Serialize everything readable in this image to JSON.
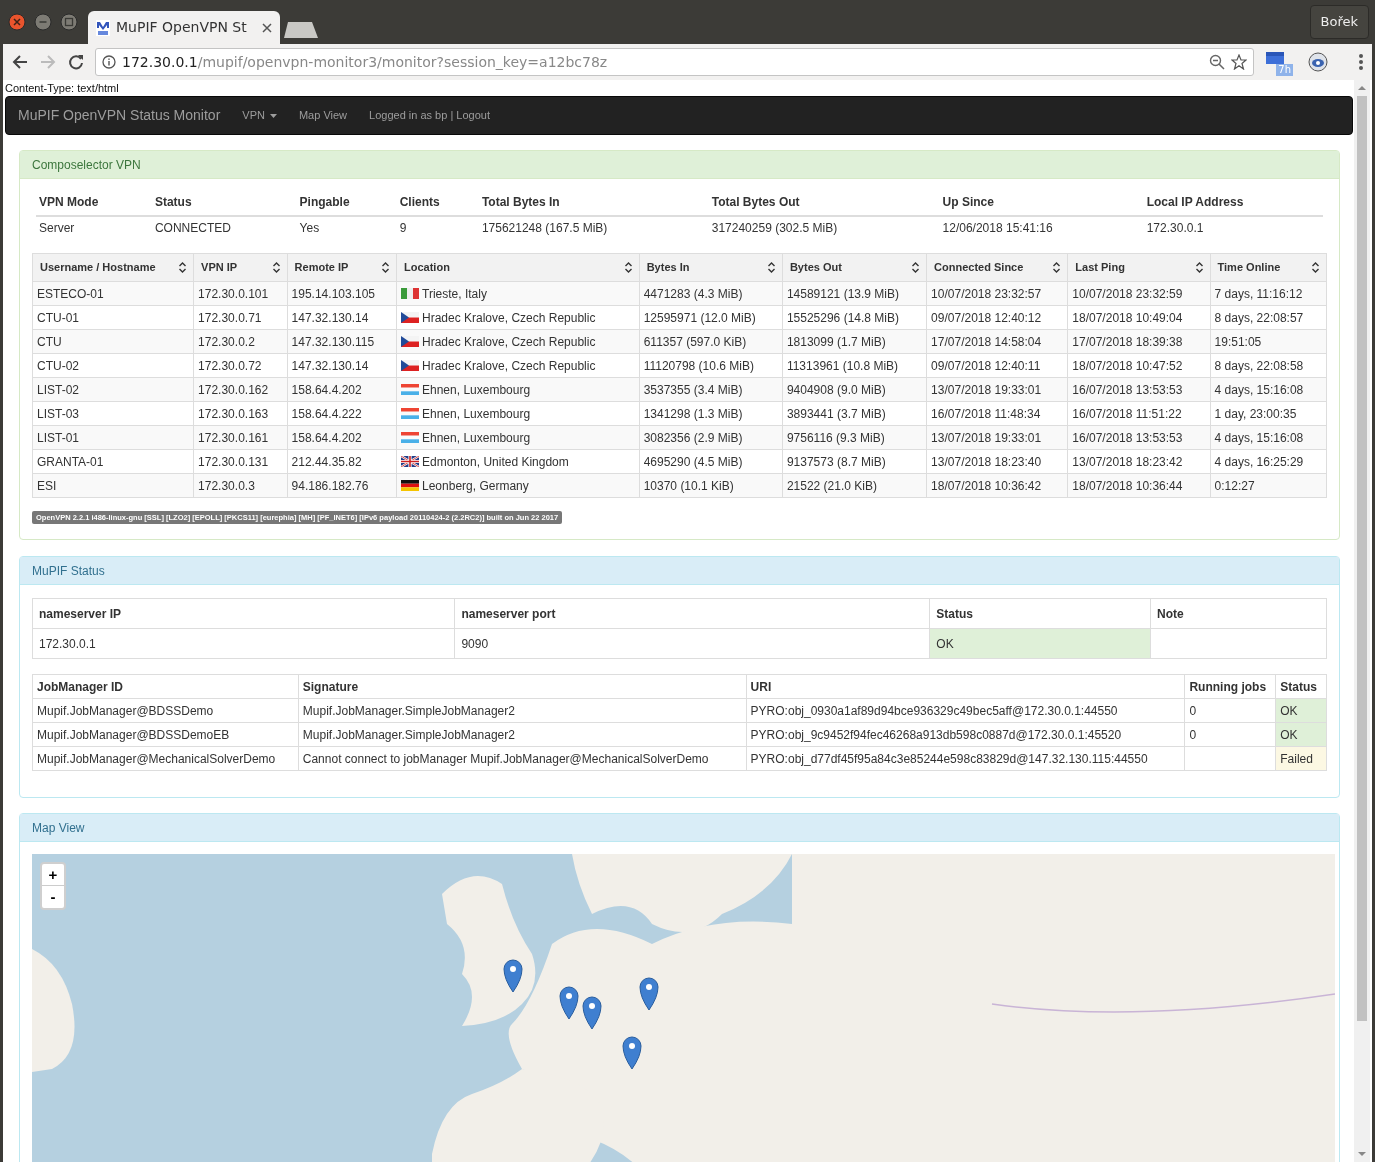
{
  "browser": {
    "tab_title": "MuPIF OpenVPN St",
    "profile": "Bořek",
    "url_host": "172.30.0.1",
    "url_path": "/mupif/openvpn-monitor3/monitor?session_key=a12bc78z",
    "forward_enabled": false,
    "extension_badge": "7h"
  },
  "content_type_line": "Content-Type: text/html",
  "navbar": {
    "brand": "MuPIF OpenVPN Status Monitor",
    "items": [
      {
        "label": "VPN",
        "kind": "dropdown"
      },
      {
        "label": "Map View",
        "kind": "link"
      },
      {
        "label": "Logged in as bp | Logout",
        "kind": "link"
      }
    ]
  },
  "vpn_panel": {
    "title": "Composelector VPN",
    "summary": {
      "columns": [
        "VPN Mode",
        "Status",
        "Pingable",
        "Clients",
        "Total Bytes In",
        "Total Bytes Out",
        "Up Since",
        "Local IP Address"
      ],
      "values": [
        "Server",
        "CONNECTED",
        "Yes",
        "9",
        "175621248 (167.5 MiB)",
        "317240259 (302.5 MiB)",
        "12/06/2018 15:41:16",
        "172.30.0.1"
      ]
    },
    "clients": {
      "columns": [
        "Username / Hostname",
        "VPN IP",
        "Remote IP",
        "Location",
        "Bytes In",
        "Bytes Out",
        "Connected Since",
        "Last Ping",
        "Time Online"
      ],
      "rows": [
        {
          "kind": "italy",
          "cells": [
            "ESTECO-01",
            "172.30.0.101",
            "195.14.103.105",
            "Trieste, Italy",
            "4471283 (4.3 MiB)",
            "14589121 (13.9 MiB)",
            "10/07/2018 23:32:57",
            "10/07/2018 23:32:59",
            "7 days, 11:16:12"
          ]
        },
        {
          "kind": "czechia",
          "cells": [
            "CTU-01",
            "172.30.0.71",
            "147.32.130.14",
            "Hradec Kralove, Czech Republic",
            "12595971 (12.0 MiB)",
            "15525296 (14.8 MiB)",
            "09/07/2018 12:40:12",
            "18/07/2018 10:49:04",
            "8 days, 22:08:57"
          ]
        },
        {
          "kind": "czechia",
          "cells": [
            "CTU",
            "172.30.0.2",
            "147.32.130.115",
            "Hradec Kralove, Czech Republic",
            "611357 (597.0 KiB)",
            "1813099 (1.7 MiB)",
            "17/07/2018 14:58:04",
            "17/07/2018 18:39:38",
            "19:51:05"
          ]
        },
        {
          "kind": "czechia",
          "cells": [
            "CTU-02",
            "172.30.0.72",
            "147.32.130.14",
            "Hradec Kralove, Czech Republic",
            "11120798 (10.6 MiB)",
            "11313961 (10.8 MiB)",
            "09/07/2018 12:40:11",
            "18/07/2018 10:47:52",
            "8 days, 22:08:58"
          ]
        },
        {
          "kind": "luxembourg",
          "cells": [
            "LIST-02",
            "172.30.0.162",
            "158.64.4.202",
            "Ehnen, Luxembourg",
            "3537355 (3.4 MiB)",
            "9404908 (9.0 MiB)",
            "13/07/2018 19:33:01",
            "16/07/2018 13:53:53",
            "4 days, 15:16:08"
          ]
        },
        {
          "kind": "luxembourg",
          "cells": [
            "LIST-03",
            "172.30.0.163",
            "158.64.4.222",
            "Ehnen, Luxembourg",
            "1341298 (1.3 MiB)",
            "3893441 (3.7 MiB)",
            "16/07/2018 11:48:34",
            "16/07/2018 11:51:22",
            "1 day, 23:00:35"
          ]
        },
        {
          "kind": "luxembourg",
          "cells": [
            "LIST-01",
            "172.30.0.161",
            "158.64.4.202",
            "Ehnen, Luxembourg",
            "3082356 (2.9 MiB)",
            "9756116 (9.3 MiB)",
            "13/07/2018 19:33:01",
            "16/07/2018 13:53:53",
            "4 days, 15:16:08"
          ]
        },
        {
          "kind": "britain",
          "cells": [
            "GRANTA-01",
            "172.30.0.131",
            "212.44.35.82",
            "Edmonton, United Kingdom",
            "4695290 (4.5 MiB)",
            "9137573 (8.7 MiB)",
            "13/07/2018 18:23:40",
            "13/07/2018 18:23:42",
            "4 days, 16:25:29"
          ]
        },
        {
          "kind": "germany",
          "cells": [
            "ESI",
            "172.30.0.3",
            "94.186.182.76",
            "Leonberg, Germany",
            "10370 (10.1 KiB)",
            "21522 (21.0 KiB)",
            "18/07/2018 10:36:42",
            "18/07/2018 10:36:44",
            "0:12:27"
          ]
        }
      ]
    },
    "version_badge": "OpenVPN 2.2.1 i486-linux-gnu [SSL] [LZO2] [EPOLL] [PKCS11] [eurephia] [MH] [PF_INET6] [IPv6 payload 20110424-2 (2.2RC2)] built on Jun 22 2017"
  },
  "mupif_panel": {
    "title": "MuPIF Status",
    "nameserver": {
      "columns": [
        "nameserver IP",
        "nameserver port",
        "Status",
        "Note"
      ],
      "values": [
        "172.30.0.1",
        "9090",
        "OK"
      ],
      "kind": "ok"
    },
    "jobmanagers": {
      "columns": [
        "JobManager ID",
        "Signature",
        "URI",
        "Running jobs",
        "Status"
      ],
      "rows": [
        {
          "id": "Mupif.JobManager@BDSSDemo",
          "signature": "Mupif.JobManager.SimpleJobManager2",
          "uri": "PYRO:obj_0930a1af89d94bce936329c49bec5aff@172.30.0.1:44550",
          "running_jobs": "0",
          "status": "OK",
          "kind": "ok"
        },
        {
          "id": "Mupif.JobManager@BDSSDemoEB",
          "signature": "Mupif.JobManager.SimpleJobManager2",
          "uri": "PYRO:obj_9c9452f94fec46268a913db598c0887d@172.30.0.1:45520",
          "running_jobs": "0",
          "status": "OK",
          "kind": "ok"
        },
        {
          "id": "Mupif.JobManager@MechanicalSolverDemo",
          "signature": "Cannot connect to jobManager Mupif.JobManager@MechanicalSolverDemo",
          "uri": "PYRO:obj_d77df45f95a84c3e85244e598c83829d@147.32.130.115:44550",
          "status": "Failed",
          "kind": "failed"
        }
      ]
    }
  },
  "map_panel": {
    "title": "Map View",
    "zoom_in": "+",
    "zoom_out": "-"
  }
}
